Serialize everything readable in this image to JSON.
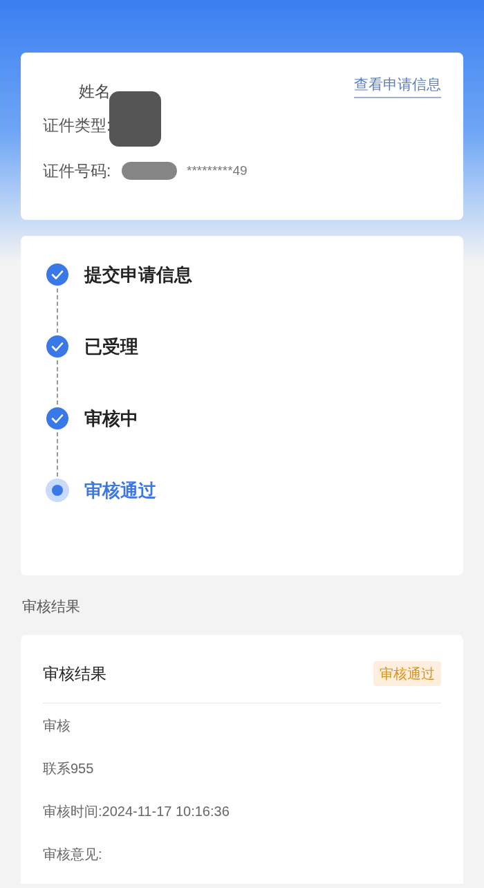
{
  "applicant": {
    "name_label": "姓名",
    "link": "查看申请信息",
    "fields": [
      {
        "label": "证件类型:"
      },
      {
        "label": "证件号码:",
        "value": "*********49"
      }
    ]
  },
  "steps": [
    {
      "label": "提交申请信息",
      "kind": "done"
    },
    {
      "label": "已受理",
      "kind": "done"
    },
    {
      "label": "审核中",
      "kind": "done"
    },
    {
      "label": "审核通过",
      "kind": "current"
    }
  ],
  "section_title": "审核结果",
  "result": {
    "title": "审核结果",
    "badge": "审核通过",
    "rows": [
      {
        "label": "审核"
      },
      {
        "label": "联系",
        "value": "955"
      },
      {
        "label": "审核时间:",
        "value": "2024-11-17 10:16:36"
      },
      {
        "label": "审核意见:"
      }
    ]
  }
}
